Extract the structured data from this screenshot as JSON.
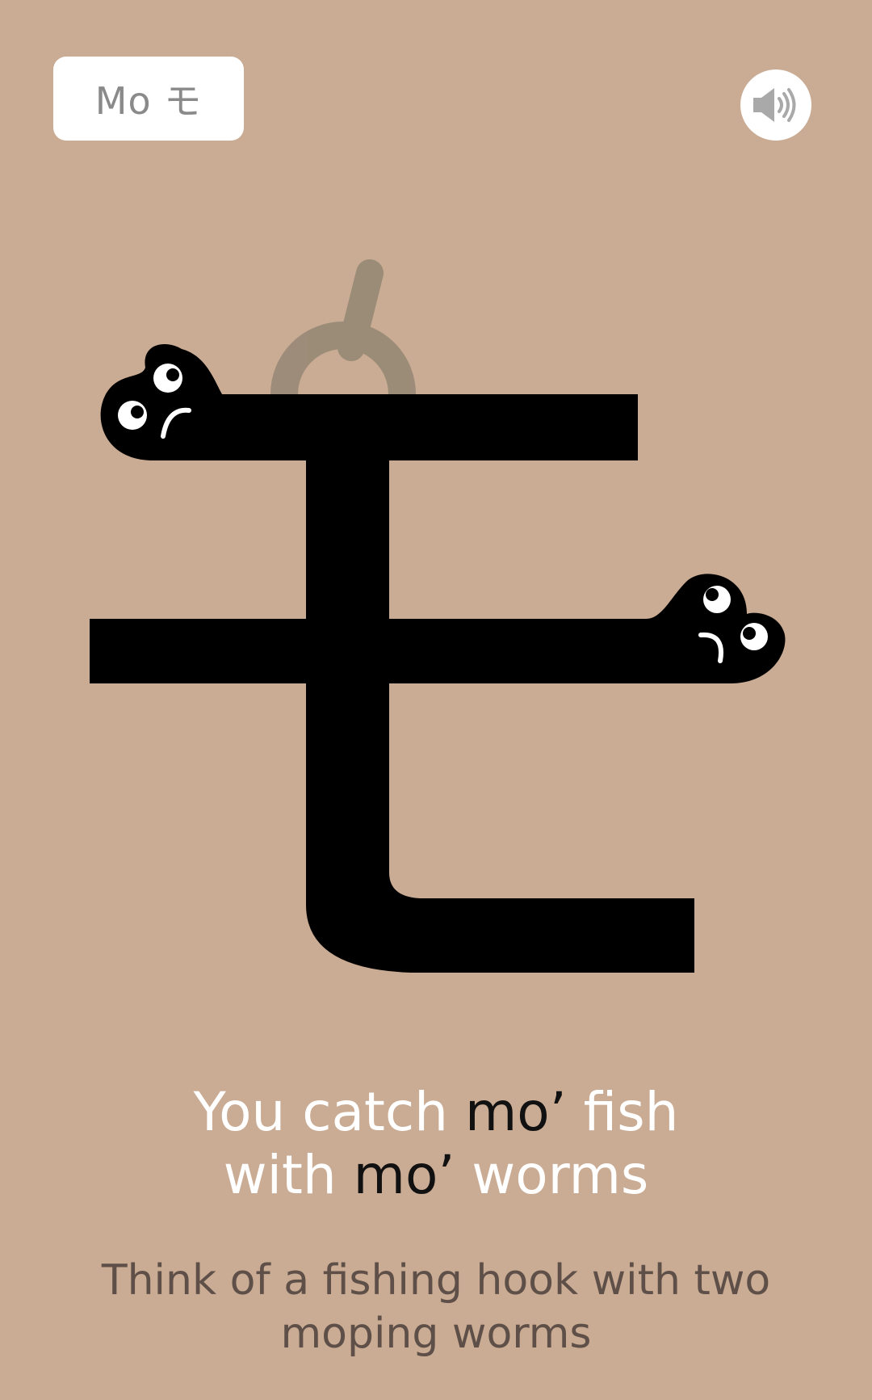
{
  "header": {
    "kana_label": "Mo モ",
    "sound_icon": "speaker-icon"
  },
  "character": {
    "kana": "モ",
    "colors": {
      "stroke": "#000000",
      "hook": "#8c8270",
      "background": "#caab93"
    }
  },
  "mnemonic": {
    "line1_prefix": "You catch ",
    "line1_highlight": "mo’",
    "line1_suffix": " fish",
    "line2_prefix": "with ",
    "line2_highlight": "mo’",
    "line2_suffix": " worms"
  },
  "hint": {
    "text": "Think of a fishing hook with two moping worms"
  }
}
